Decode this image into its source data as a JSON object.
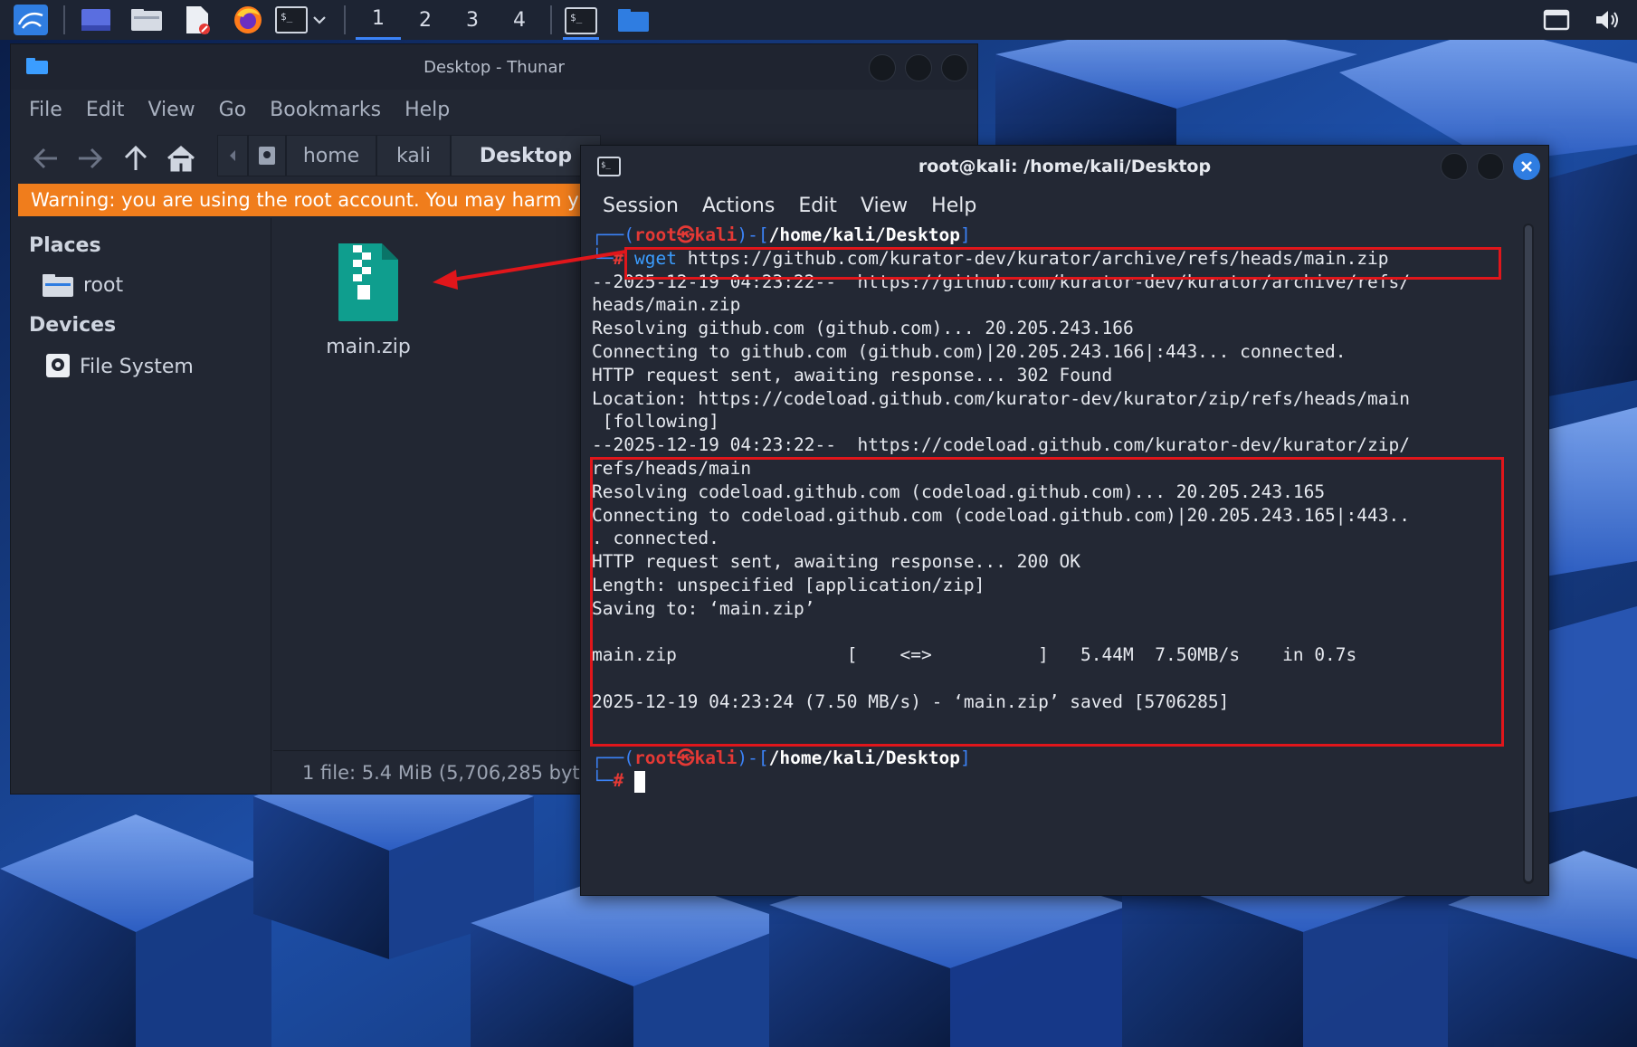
{
  "top_panel": {
    "workspaces": [
      "1",
      "2",
      "3",
      "4"
    ],
    "active_workspace": "1"
  },
  "thunar": {
    "title": "Desktop - Thunar",
    "menu": [
      "File",
      "Edit",
      "View",
      "Go",
      "Bookmarks",
      "Help"
    ],
    "breadcrumbs": [
      "home",
      "kali",
      "Desktop"
    ],
    "warning": "Warning: you are using the root account. You may harm y",
    "sidebar": {
      "places_heading": "Places",
      "places": [
        "root"
      ],
      "devices_heading": "Devices",
      "devices": [
        "File System"
      ]
    },
    "file": {
      "name": "main.zip"
    },
    "status": "1 file: 5.4 MiB (5,706,285 byte"
  },
  "terminal": {
    "title": "root@kali: /home/kali/Desktop",
    "menu": [
      "Session",
      "Actions",
      "Edit",
      "View",
      "Help"
    ],
    "prompt_user": "root",
    "prompt_host": "kali",
    "prompt_path": "/home/kali/Desktop",
    "command_name": "wget",
    "command_args": " https://github.com/kurator-dev/kurator/archive/refs/heads/main.zip",
    "output": [
      "--2025-12-19 04:23:22--  https://github.com/kurator-dev/kurator/archive/refs/",
      "heads/main.zip",
      "Resolving github.com (github.com)... 20.205.243.166",
      "Connecting to github.com (github.com)|20.205.243.166|:443... connected.",
      "HTTP request sent, awaiting response... 302 Found",
      "Location: https://codeload.github.com/kurator-dev/kurator/zip/refs/heads/main",
      " [following]",
      "--2025-12-19 04:23:22--  https://codeload.github.com/kurator-dev/kurator/zip/",
      "refs/heads/main",
      "Resolving codeload.github.com (codeload.github.com)... 20.205.243.165",
      "Connecting to codeload.github.com (codeload.github.com)|20.205.243.165|:443..",
      ". connected.",
      "HTTP request sent, awaiting response... 200 OK",
      "Length: unspecified [application/zip]",
      "Saving to: ‘main.zip’",
      "",
      "main.zip                [    <=>          ]   5.44M  7.50MB/s    in 0.7s",
      "",
      "2025-12-19 04:23:24 (7.50 MB/s) - ‘main.zip’ saved [5706285]",
      ""
    ]
  },
  "colors": {
    "accent": "#3b82f6",
    "warning": "#f07d1c",
    "annotation": "#e0161b",
    "prompt_red": "#e53935"
  }
}
